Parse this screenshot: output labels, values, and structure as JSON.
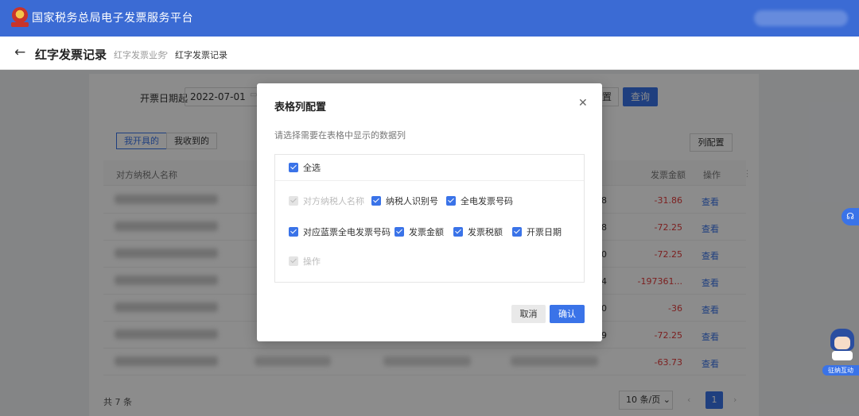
{
  "app": {
    "title": "国家税务总局电子发票服务平台"
  },
  "page": {
    "title": "红字发票记录",
    "breadcrumb": [
      "红字发票业务",
      "红字发票记录"
    ]
  },
  "filter": {
    "date_label": "开票日期起",
    "date_value": "2022-07-01",
    "reset_label": "置",
    "query_label": "查询"
  },
  "tabs": [
    "我开具的",
    "我收到的"
  ],
  "column_config_label": "列配置",
  "table": {
    "headers": {
      "name": "对方纳税人名称",
      "amount": "发票金额",
      "op": "操作"
    },
    "rows": [
      {
        "digit": "8",
        "amount": "-31.86",
        "op": "查看"
      },
      {
        "digit": "8",
        "amount": "-72.25",
        "op": "查看"
      },
      {
        "digit": "0",
        "amount": "-72.25",
        "op": "查看"
      },
      {
        "digit": "4",
        "amount": "-197361...",
        "op": "查看"
      },
      {
        "digit": "0",
        "amount": "-36",
        "op": "查看"
      },
      {
        "digit": "9",
        "amount": "-72.25",
        "op": "查看"
      },
      {
        "digit": "",
        "amount": "-63.73",
        "op": "查看"
      }
    ]
  },
  "pagination": {
    "total": "共 7 条",
    "page_size": "10 条/页",
    "current_page": "1"
  },
  "modal": {
    "title": "表格列配置",
    "description": "请选择需要在表格中显示的数据列",
    "select_all": "全选",
    "options": {
      "name": "对方纳税人名称",
      "tax_id": "纳税人识别号",
      "invoice_no": "全电发票号码",
      "blue_no": "对应蓝票全电发票号码",
      "amount": "发票金额",
      "tax": "发票税额",
      "date": "开票日期",
      "op": "操作"
    },
    "cancel_label": "取消",
    "ok_label": "确认"
  },
  "widgets": {
    "robot_label": "征纳互动"
  },
  "colors": {
    "primary": "#3a73e8",
    "header": "#3b6bd4",
    "negative": "#e23b3b"
  }
}
